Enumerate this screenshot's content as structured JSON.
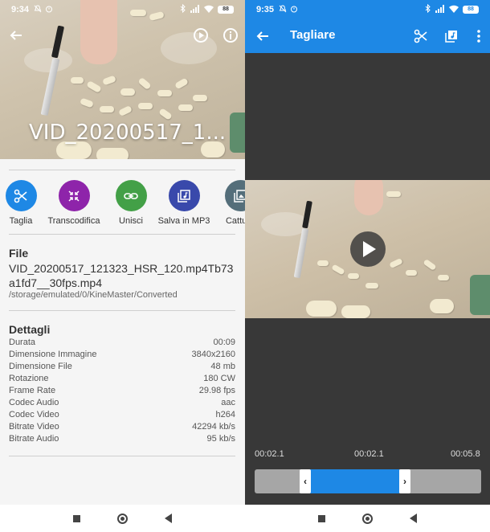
{
  "left": {
    "status": {
      "time": "9:34",
      "battery": "88"
    },
    "video_title": "VID_20200517_1...",
    "actions": [
      {
        "label": "Taglia",
        "icon": "scissors-icon",
        "color": "#1e88e5"
      },
      {
        "label": "Transcodifica",
        "icon": "compress-icon",
        "color": "#8e24aa"
      },
      {
        "label": "Unisci",
        "icon": "link-icon",
        "color": "#43a047"
      },
      {
        "label": "Salva in MP3",
        "icon": "music-library-icon",
        "color": "#3949ab"
      },
      {
        "label": "Cattura",
        "icon": "photo-library-icon",
        "color": "#546e7a"
      }
    ],
    "file": {
      "heading": "File",
      "name": "VID_20200517_121323_HSR_120.mp4Tb73a1fd7__30fps.mp4",
      "path": "/storage/emulated/0/KineMaster/Converted"
    },
    "details": {
      "heading": "Dettagli",
      "rows": [
        {
          "label": "Durata",
          "value": "00:09"
        },
        {
          "label": "Dimensione Immagine",
          "value": "3840x2160"
        },
        {
          "label": "Dimensione File",
          "value": "48 mb"
        },
        {
          "label": "Rotazione",
          "value": "180 CW"
        },
        {
          "label": "Frame Rate",
          "value": "29.98 fps"
        },
        {
          "label": "Codec Audio",
          "value": "aac"
        },
        {
          "label": "Codec Video",
          "value": "h264"
        },
        {
          "label": "Bitrate Video",
          "value": "42294 kb/s"
        },
        {
          "label": "Bitrate Audio",
          "value": "95 kb/s"
        }
      ]
    }
  },
  "right": {
    "status": {
      "time": "9:35",
      "battery": "88"
    },
    "title": "Tagliare",
    "accent": "#1e88e5",
    "times": {
      "start": "00:02.1",
      "current": "00:02.1",
      "end": "00:05.8"
    },
    "trim": {
      "left_handle": "‹",
      "right_handle": "›"
    }
  }
}
